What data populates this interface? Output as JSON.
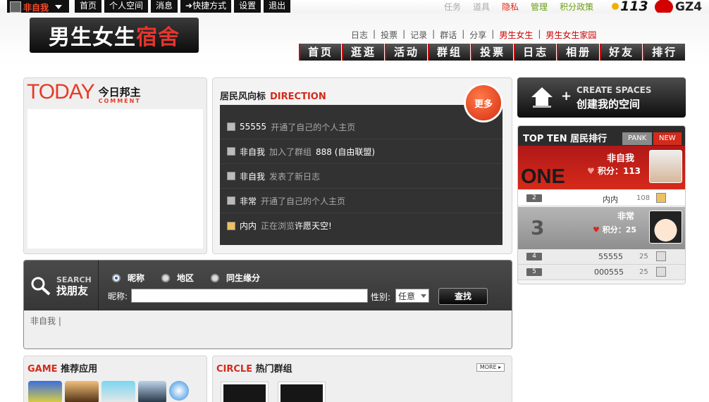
{
  "topbar": {
    "username": "非自我",
    "nav": [
      "首页",
      "个人空间",
      "消息",
      "快捷方式",
      "设置",
      "退出"
    ],
    "right_links": [
      {
        "label": "任务",
        "color": "#aaaaaa"
      },
      {
        "label": "道具",
        "color": "#aaaaaa"
      },
      {
        "label": "隐私",
        "color": "#dd2a1a"
      },
      {
        "label": "管理",
        "color": "#6aa012"
      },
      {
        "label": "积分政策",
        "color": "#6aa012"
      }
    ],
    "points": "113",
    "brand": "GZ4"
  },
  "header": {
    "logo_white": "男生女生",
    "logo_red": "宿舍",
    "sublinks": [
      "日志",
      "投票",
      "记录",
      "群话",
      "分享",
      "男生女生",
      "男生女生家园"
    ],
    "main_nav": [
      "首页",
      "逛逛",
      "活动",
      "群组",
      "投票",
      "日志",
      "相册",
      "好友",
      "排行"
    ]
  },
  "today": {
    "title": "TODAY",
    "cn": "今日邦主",
    "en": "COMMENT"
  },
  "direction": {
    "title_cn": "居民风向标",
    "title_en": "DIRECTION",
    "more": "更多",
    "feed": [
      {
        "user": "55555",
        "action": "开通了自己的个人主页",
        "extra": ""
      },
      {
        "user": "非自我",
        "action": "加入了群组",
        "extra": "888 (自由联盟)"
      },
      {
        "user": "非自我",
        "action": "发表了新日志",
        "extra": ""
      },
      {
        "user": "非常",
        "action": "开通了自己的个人主页",
        "extra": ""
      },
      {
        "user": "内内",
        "action": "正在浏览",
        "extra": "许愿天空!"
      }
    ]
  },
  "create": {
    "en": "CREATE SPACES",
    "cn": "创建我的空间"
  },
  "topten": {
    "title": "TOP TEN 居民排行",
    "tab_rank": "PANK",
    "tab_new": "NEW",
    "one_word": "ONE",
    "first": {
      "name": "非自我",
      "points": "积分：113"
    },
    "second": {
      "rank": "2",
      "name": "内内",
      "value": "108"
    },
    "third": {
      "rank": "3",
      "name": "非常",
      "points": "积分：25"
    },
    "rows": [
      {
        "rank": "4",
        "name": "55555",
        "value": "25"
      },
      {
        "rank": "5",
        "name": "000555",
        "value": "25"
      }
    ]
  },
  "search": {
    "en": "SEARCH",
    "cn": "找朋友",
    "options": [
      "昵称",
      "地区",
      "同生缘分"
    ],
    "field_label": "昵称:",
    "gender_label": "性别:",
    "gender_value": "任意",
    "button": "查找",
    "result_text": "非自我 |"
  },
  "game": {
    "en": "GAME",
    "cn": "推荐应用"
  },
  "circle": {
    "en": "CIRCLE",
    "cn": "热门群组",
    "more": "MORE ▸"
  }
}
